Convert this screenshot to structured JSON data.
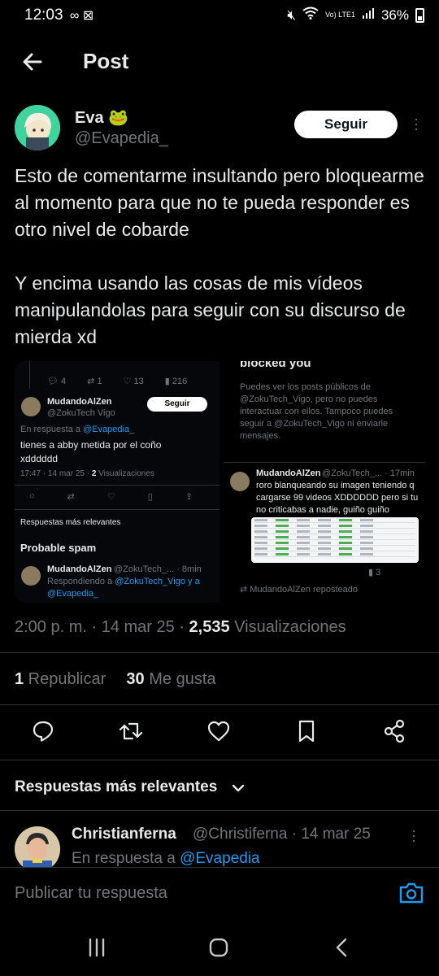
{
  "status_bar": {
    "time": "12:03",
    "left_icons": "∞ ⊠",
    "lte": "Vo) LTE1",
    "battery": "36%"
  },
  "header": {
    "title": "Post"
  },
  "post": {
    "author_name": "Eva 🐸",
    "author_handle": "@Evapedia_",
    "follow_label": "Seguir",
    "paragraph1": "Esto de comentarme insultando pero bloquearme al momento para que no te pueda responder es otro nivel de cobarde",
    "paragraph2": "Y encima usando las cosas de mis vídeos manipulandolas para seguir con su discurso de mierda xd",
    "timestamp": "2:00 p. m. · 14 mar 25 · ",
    "views_count": "2,535",
    "views_label": " Visualizaciones",
    "reposts_count": "1",
    "reposts_label": " Republicar",
    "likes_count": "30",
    "likes_label": " Me gusta"
  },
  "embedded_left": {
    "stat_replies": "4",
    "stat_reposts": "1",
    "stat_likes": "13",
    "stat_views": "216",
    "name": "MudandoAlZen",
    "handle": "@ZokuTech Vigo",
    "follow_label": "Seguir",
    "reply_prefix": "En respuesta a ",
    "reply_handle": "@Evapedia_",
    "text_line1": "tienes a abby metida por el coño",
    "text_line2": "xdddddd",
    "time": "17:47 · 14 mar 25 · ",
    "views_count": "2",
    "views_label": " Visualizaciones",
    "relevant_label": "Respuestas más relevantes",
    "spam_label": "Probable spam",
    "reply2_name": "MudandoAlZen",
    "reply2_handle": "@ZokuTech_... · 8min",
    "reply2_prefix": "Respondiendo a ",
    "reply2_handles1": "@ZokuTech_Vigo y a",
    "reply2_handles2": "@Evapedia_"
  },
  "embedded_right": {
    "blocked_title": "blocked you",
    "blocked_line1": "Puedes ver los posts públicos de",
    "blocked_line2": "@ZokuTech_Vigo, pero no puedes",
    "blocked_line3": "interactuar con ellos. Tampoco puedes",
    "blocked_line4": "seguir a @ZokuTech_Vigo ni enviarle",
    "blocked_line5": "mensajes.",
    "name": "MudandoAlZen",
    "handle": "@ZokuTech_... · 17min",
    "text_line1": "roro blanqueando su imagen teniendo q",
    "text_line2": "cargarse 99 videos XDDDDDD pero si tu",
    "text_line3": "no criticabas a nadie, guiño guiño",
    "views": "3",
    "reposted_label": "MudandoAlZen reposteado"
  },
  "replies": {
    "section_label": "Respuestas más relevantes",
    "first": {
      "name": "Christianferna",
      "meta": "@Christiferna · 14 mar 25",
      "reply_prefix": "En respuesta a ",
      "reply_handle": "@Evapedia"
    }
  },
  "composer": {
    "placeholder": "Publicar tu respuesta"
  },
  "icons": {
    "back": "arrow-left-icon",
    "reply": "reply-icon",
    "repost": "repost-icon",
    "like": "heart-icon",
    "bookmark": "bookmark-icon",
    "share": "share-icon",
    "camera": "camera-icon"
  },
  "colors": {
    "accent": "#1d9bf0",
    "background": "#000000",
    "muted": "#71767b",
    "text": "#e7e9ea"
  }
}
